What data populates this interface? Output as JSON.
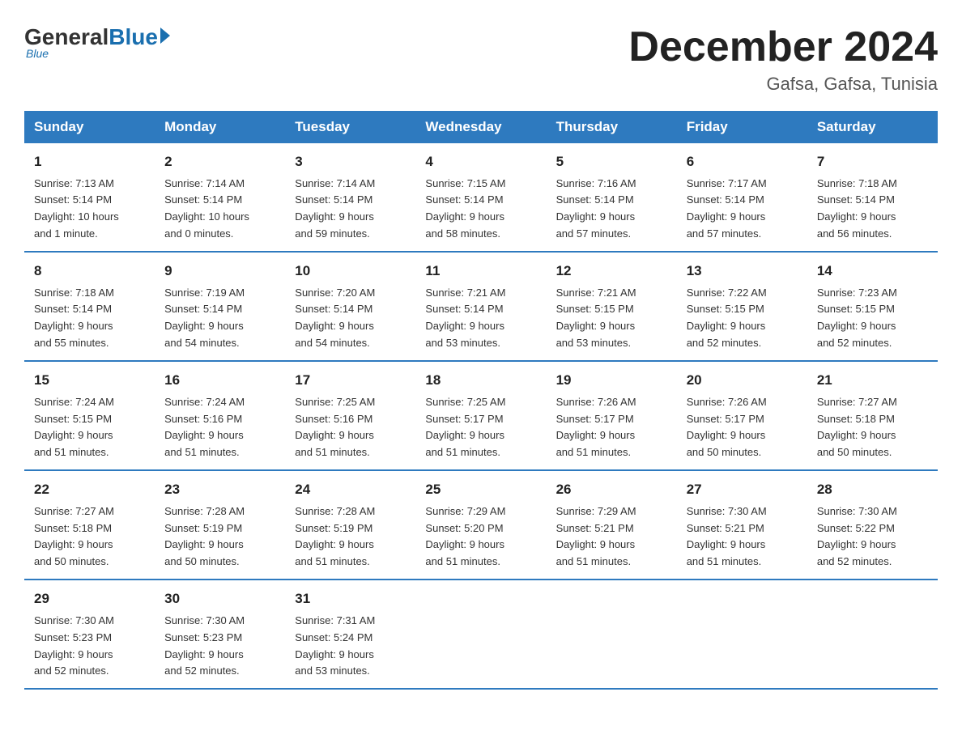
{
  "header": {
    "logo_general": "General",
    "logo_blue": "Blue",
    "month_title": "December 2024",
    "location": "Gafsa, Gafsa, Tunisia"
  },
  "weekdays": [
    "Sunday",
    "Monday",
    "Tuesday",
    "Wednesday",
    "Thursday",
    "Friday",
    "Saturday"
  ],
  "weeks": [
    [
      {
        "day": "1",
        "info": "Sunrise: 7:13 AM\nSunset: 5:14 PM\nDaylight: 10 hours\nand 1 minute."
      },
      {
        "day": "2",
        "info": "Sunrise: 7:14 AM\nSunset: 5:14 PM\nDaylight: 10 hours\nand 0 minutes."
      },
      {
        "day": "3",
        "info": "Sunrise: 7:14 AM\nSunset: 5:14 PM\nDaylight: 9 hours\nand 59 minutes."
      },
      {
        "day": "4",
        "info": "Sunrise: 7:15 AM\nSunset: 5:14 PM\nDaylight: 9 hours\nand 58 minutes."
      },
      {
        "day": "5",
        "info": "Sunrise: 7:16 AM\nSunset: 5:14 PM\nDaylight: 9 hours\nand 57 minutes."
      },
      {
        "day": "6",
        "info": "Sunrise: 7:17 AM\nSunset: 5:14 PM\nDaylight: 9 hours\nand 57 minutes."
      },
      {
        "day": "7",
        "info": "Sunrise: 7:18 AM\nSunset: 5:14 PM\nDaylight: 9 hours\nand 56 minutes."
      }
    ],
    [
      {
        "day": "8",
        "info": "Sunrise: 7:18 AM\nSunset: 5:14 PM\nDaylight: 9 hours\nand 55 minutes."
      },
      {
        "day": "9",
        "info": "Sunrise: 7:19 AM\nSunset: 5:14 PM\nDaylight: 9 hours\nand 54 minutes."
      },
      {
        "day": "10",
        "info": "Sunrise: 7:20 AM\nSunset: 5:14 PM\nDaylight: 9 hours\nand 54 minutes."
      },
      {
        "day": "11",
        "info": "Sunrise: 7:21 AM\nSunset: 5:14 PM\nDaylight: 9 hours\nand 53 minutes."
      },
      {
        "day": "12",
        "info": "Sunrise: 7:21 AM\nSunset: 5:15 PM\nDaylight: 9 hours\nand 53 minutes."
      },
      {
        "day": "13",
        "info": "Sunrise: 7:22 AM\nSunset: 5:15 PM\nDaylight: 9 hours\nand 52 minutes."
      },
      {
        "day": "14",
        "info": "Sunrise: 7:23 AM\nSunset: 5:15 PM\nDaylight: 9 hours\nand 52 minutes."
      }
    ],
    [
      {
        "day": "15",
        "info": "Sunrise: 7:24 AM\nSunset: 5:15 PM\nDaylight: 9 hours\nand 51 minutes."
      },
      {
        "day": "16",
        "info": "Sunrise: 7:24 AM\nSunset: 5:16 PM\nDaylight: 9 hours\nand 51 minutes."
      },
      {
        "day": "17",
        "info": "Sunrise: 7:25 AM\nSunset: 5:16 PM\nDaylight: 9 hours\nand 51 minutes."
      },
      {
        "day": "18",
        "info": "Sunrise: 7:25 AM\nSunset: 5:17 PM\nDaylight: 9 hours\nand 51 minutes."
      },
      {
        "day": "19",
        "info": "Sunrise: 7:26 AM\nSunset: 5:17 PM\nDaylight: 9 hours\nand 51 minutes."
      },
      {
        "day": "20",
        "info": "Sunrise: 7:26 AM\nSunset: 5:17 PM\nDaylight: 9 hours\nand 50 minutes."
      },
      {
        "day": "21",
        "info": "Sunrise: 7:27 AM\nSunset: 5:18 PM\nDaylight: 9 hours\nand 50 minutes."
      }
    ],
    [
      {
        "day": "22",
        "info": "Sunrise: 7:27 AM\nSunset: 5:18 PM\nDaylight: 9 hours\nand 50 minutes."
      },
      {
        "day": "23",
        "info": "Sunrise: 7:28 AM\nSunset: 5:19 PM\nDaylight: 9 hours\nand 50 minutes."
      },
      {
        "day": "24",
        "info": "Sunrise: 7:28 AM\nSunset: 5:19 PM\nDaylight: 9 hours\nand 51 minutes."
      },
      {
        "day": "25",
        "info": "Sunrise: 7:29 AM\nSunset: 5:20 PM\nDaylight: 9 hours\nand 51 minutes."
      },
      {
        "day": "26",
        "info": "Sunrise: 7:29 AM\nSunset: 5:21 PM\nDaylight: 9 hours\nand 51 minutes."
      },
      {
        "day": "27",
        "info": "Sunrise: 7:30 AM\nSunset: 5:21 PM\nDaylight: 9 hours\nand 51 minutes."
      },
      {
        "day": "28",
        "info": "Sunrise: 7:30 AM\nSunset: 5:22 PM\nDaylight: 9 hours\nand 52 minutes."
      }
    ],
    [
      {
        "day": "29",
        "info": "Sunrise: 7:30 AM\nSunset: 5:23 PM\nDaylight: 9 hours\nand 52 minutes."
      },
      {
        "day": "30",
        "info": "Sunrise: 7:30 AM\nSunset: 5:23 PM\nDaylight: 9 hours\nand 52 minutes."
      },
      {
        "day": "31",
        "info": "Sunrise: 7:31 AM\nSunset: 5:24 PM\nDaylight: 9 hours\nand 53 minutes."
      },
      {
        "day": "",
        "info": ""
      },
      {
        "day": "",
        "info": ""
      },
      {
        "day": "",
        "info": ""
      },
      {
        "day": "",
        "info": ""
      }
    ]
  ]
}
